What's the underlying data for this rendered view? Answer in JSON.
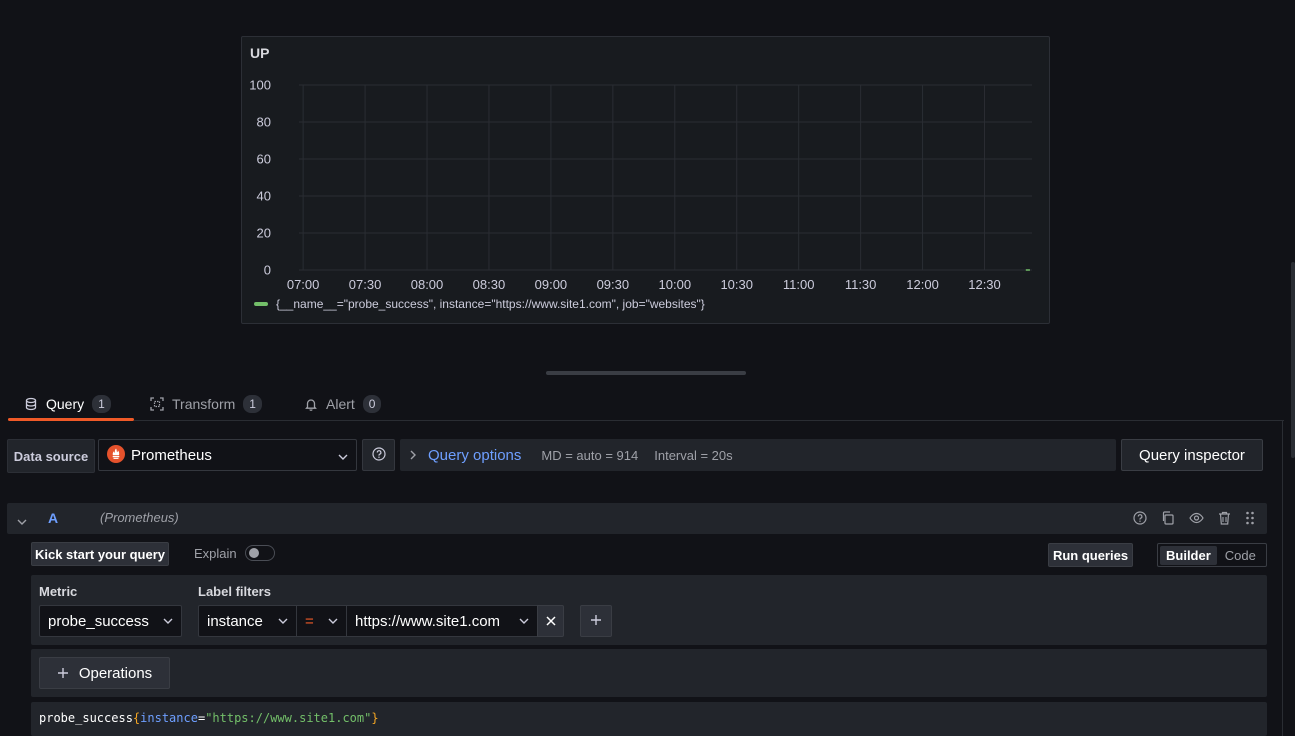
{
  "panel": {
    "title": "UP",
    "legend": "{__name__=\"probe_success\", instance=\"https://www.site1.com\", job=\"websites\"}"
  },
  "chart_data": {
    "type": "line",
    "title": "UP",
    "x_ticks": [
      "07:00",
      "07:30",
      "08:00",
      "08:30",
      "09:00",
      "09:30",
      "10:00",
      "10:30",
      "11:00",
      "11:30",
      "12:00",
      "12:30"
    ],
    "y_ticks": [
      0,
      20,
      40,
      60,
      80,
      100
    ],
    "ylim": [
      0,
      100
    ],
    "grid": true,
    "legend_placement": "bottom-left",
    "series": [
      {
        "name": "{__name__=\"probe_success\", instance=\"https://www.site1.com\", job=\"websites\"}",
        "color": "#73bf69",
        "x": [
          "12:50",
          "12:52"
        ],
        "values": [
          0,
          0
        ]
      }
    ]
  },
  "tabs": [
    {
      "label": "Query",
      "count": "1",
      "icon": "database-icon"
    },
    {
      "label": "Transform",
      "count": "1",
      "icon": "transform-icon"
    },
    {
      "label": "Alert",
      "count": "0",
      "icon": "bell-icon"
    }
  ],
  "datasource": {
    "label": "Data source",
    "selected": "Prometheus",
    "icon": "prometheus-icon",
    "query_options_label": "Query options",
    "md_info": "MD = auto = 914",
    "interval_info": "Interval = 20s",
    "inspector_label": "Query inspector"
  },
  "query": {
    "ref_id": "A",
    "datasource_hint": "(Prometheus)",
    "kick_start_label": "Kick start your query",
    "explain_label": "Explain",
    "explain_on": false,
    "run_label": "Run queries",
    "mode_builder": "Builder",
    "mode_code": "Code",
    "metric_label": "Metric",
    "metric_value": "probe_success",
    "label_filters_label": "Label filters",
    "filter_label": "instance",
    "filter_op": "=",
    "filter_value": "https://www.site1.com",
    "operations_label": "Operations",
    "preview": {
      "metric": "probe_success",
      "open": "{",
      "label": "instance",
      "eq": "=",
      "value": "\"https://www.site1.com\"",
      "close": "}"
    }
  },
  "colors": {
    "accent": "#f05a28",
    "link": "#6e9fff",
    "series": "#73bf69"
  }
}
